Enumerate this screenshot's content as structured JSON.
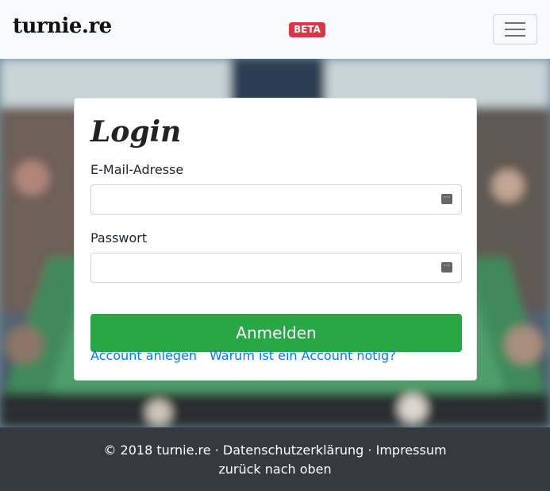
{
  "navbar": {
    "brand": "turnie.re",
    "badge": "BETA"
  },
  "login": {
    "title": "Login",
    "email_label": "E-Mail-Adresse",
    "email_value": "",
    "password_label": "Passwort",
    "password_value": "",
    "field_icon": "password-manager-icon",
    "submit_label": "Anmelden",
    "register_link": "Account anlegen",
    "why_link": "Warum ist ein Account nötig?"
  },
  "footer": {
    "copyright": "© 2018 turnie.re",
    "separator": "·",
    "privacy_link": "Datenschutzerklärung",
    "imprint_link": "Impressum",
    "back_to_top": "zurück nach oben"
  },
  "colors": {
    "navbar_bg": "#f8f9fa",
    "badge_bg": "#dc3545",
    "primary_button": "#28a745",
    "link": "#007bff",
    "footer_bg": "#343a40"
  }
}
